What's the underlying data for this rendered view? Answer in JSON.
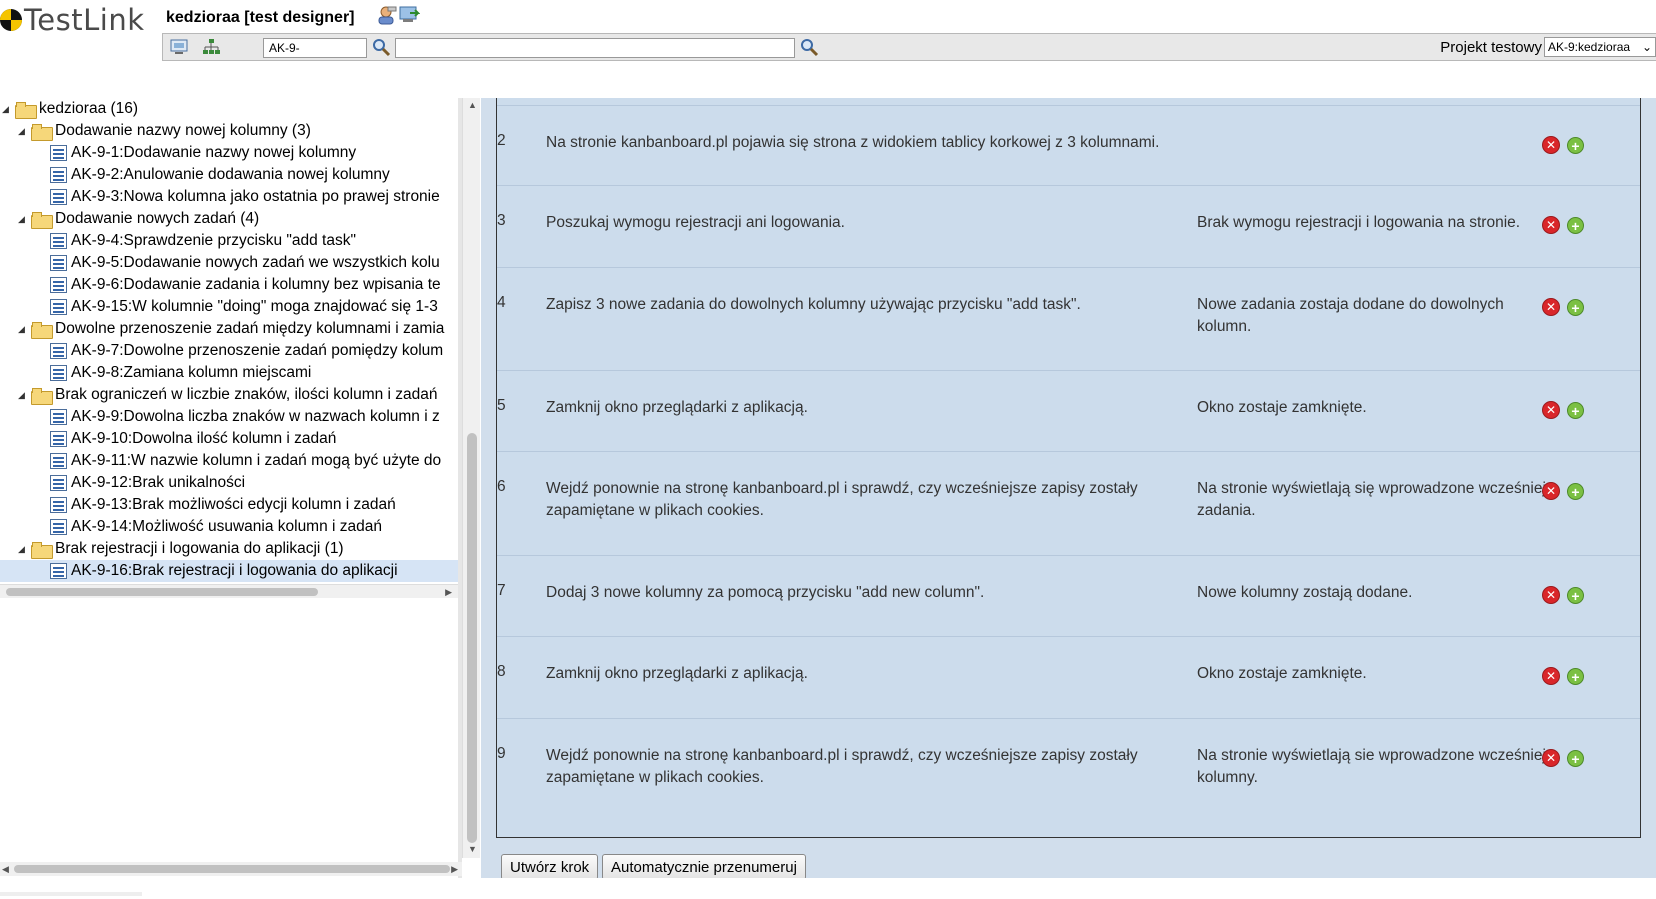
{
  "header": {
    "logo_text": "TestLink",
    "user_title": "kedzioraa [test designer]",
    "search_value": "AK-9-",
    "search2_value": "",
    "project_label": "Projekt testowy",
    "project_selected": "AK-9:kedzioraa"
  },
  "tree": {
    "root": "kedzioraa (16)",
    "s1": "Dodawanie nazwy nowej kolumny (3)",
    "t1": "AK-9-1:Dodawanie nazwy nowej kolumny",
    "t2": "AK-9-2:Anulowanie dodawania nowej kolumny",
    "t3": "AK-9-3:Nowa kolumna jako ostatnia po prawej stronie",
    "s2": "Dodawanie nowych zadań (4)",
    "t4": "AK-9-4:Sprawdzenie przycisku \"add task\"",
    "t5": "AK-9-5:Dodawanie nowych zadań we wszystkich kolu",
    "t6": "AK-9-6:Dodawanie zadania i kolumny bez wpisania te",
    "t7": "AK-9-15:W kolumnie \"doing\" moga znajdować się 1-3",
    "s3": "Dowolne przenoszenie zadań między kolumnami i zamia",
    "t8": "AK-9-7:Dowolne przenoszenie zadań pomiędzy kolum",
    "t9": "AK-9-8:Zamiana kolumn miejscami",
    "s4": "Brak ograniczeń w liczbie znaków, ilości kolumn i zadań",
    "t10": "AK-9-9:Dowolna liczba znaków w nazwach kolumn i z",
    "t11": "AK-9-10:Dowolna ilość kolumn i zadań",
    "t12": "AK-9-11:W nazwie kolumn i zadań mogą być użyte do",
    "t13": "AK-9-12:Brak unikalności",
    "t14": "AK-9-13:Brak możliwości edycji kolumn i zadań",
    "t15": "AK-9-14:Możliwość usuwania kolumn i zadań",
    "s5": "Brak rejestracji i logowania do aplikacji (1)",
    "t16": "AK-9-16:Brak rejestracji i logowania do aplikacji"
  },
  "steps": [
    {
      "num": "2",
      "action": "Na stronie kanbanboard.pl pojawia się strona z widokiem tablicy korkowej z 3 kolumnami.",
      "result": ""
    },
    {
      "num": "3",
      "action": "Poszukaj wymogu rejestracji ani logowania.",
      "result": "Brak wymogu rejestracji i logowania na stronie."
    },
    {
      "num": "4",
      "action": "Zapisz 3 nowe zadania do dowolnych kolumny używając przycisku \"add task\".",
      "result": "Nowe zadania zostaja dodane do dowolnych kolumn."
    },
    {
      "num": "5",
      "action": "Zamknij okno przeglądarki z aplikacją.",
      "result": "Okno zostaje zamknięte."
    },
    {
      "num": "6",
      "action": "Wejdź ponownie na stronę kanbanboard.pl i sprawdź, czy wcześniejsze zapisy zostały zapamiętane w plikach cookies.",
      "result": "Na stronie wyświetlają się wprowadzone wcześniej zadania."
    },
    {
      "num": "7",
      "action": "Dodaj 3 nowe kolumny za pomocą przycisku \"add new column\".",
      "result": "Nowe kolumny zostają dodane."
    },
    {
      "num": "8",
      "action": "Zamknij okno przeglądarki z aplikacją.",
      "result": "Okno zostaje zamknięte."
    },
    {
      "num": "9",
      "action": "Wejdź ponownie na stronę kanbanboard.pl i sprawdź, czy wcześniejsze zapisy zostały zapamiętane w plikach cookies.",
      "result": "Na stronie wyświetlają sie wprowadzone wcześniej kolumny."
    }
  ],
  "buttons": {
    "create_step": "Utwórz krok",
    "renumber": "Automatycznie przenumeruj"
  },
  "icons": {
    "delete": "delete-step-icon",
    "add": "add-step-icon"
  },
  "colors": {
    "content_bg": "#d1deec",
    "selected_row": "#d6e4f5",
    "delete_red": "#d9262a",
    "add_green": "#7bc043"
  }
}
